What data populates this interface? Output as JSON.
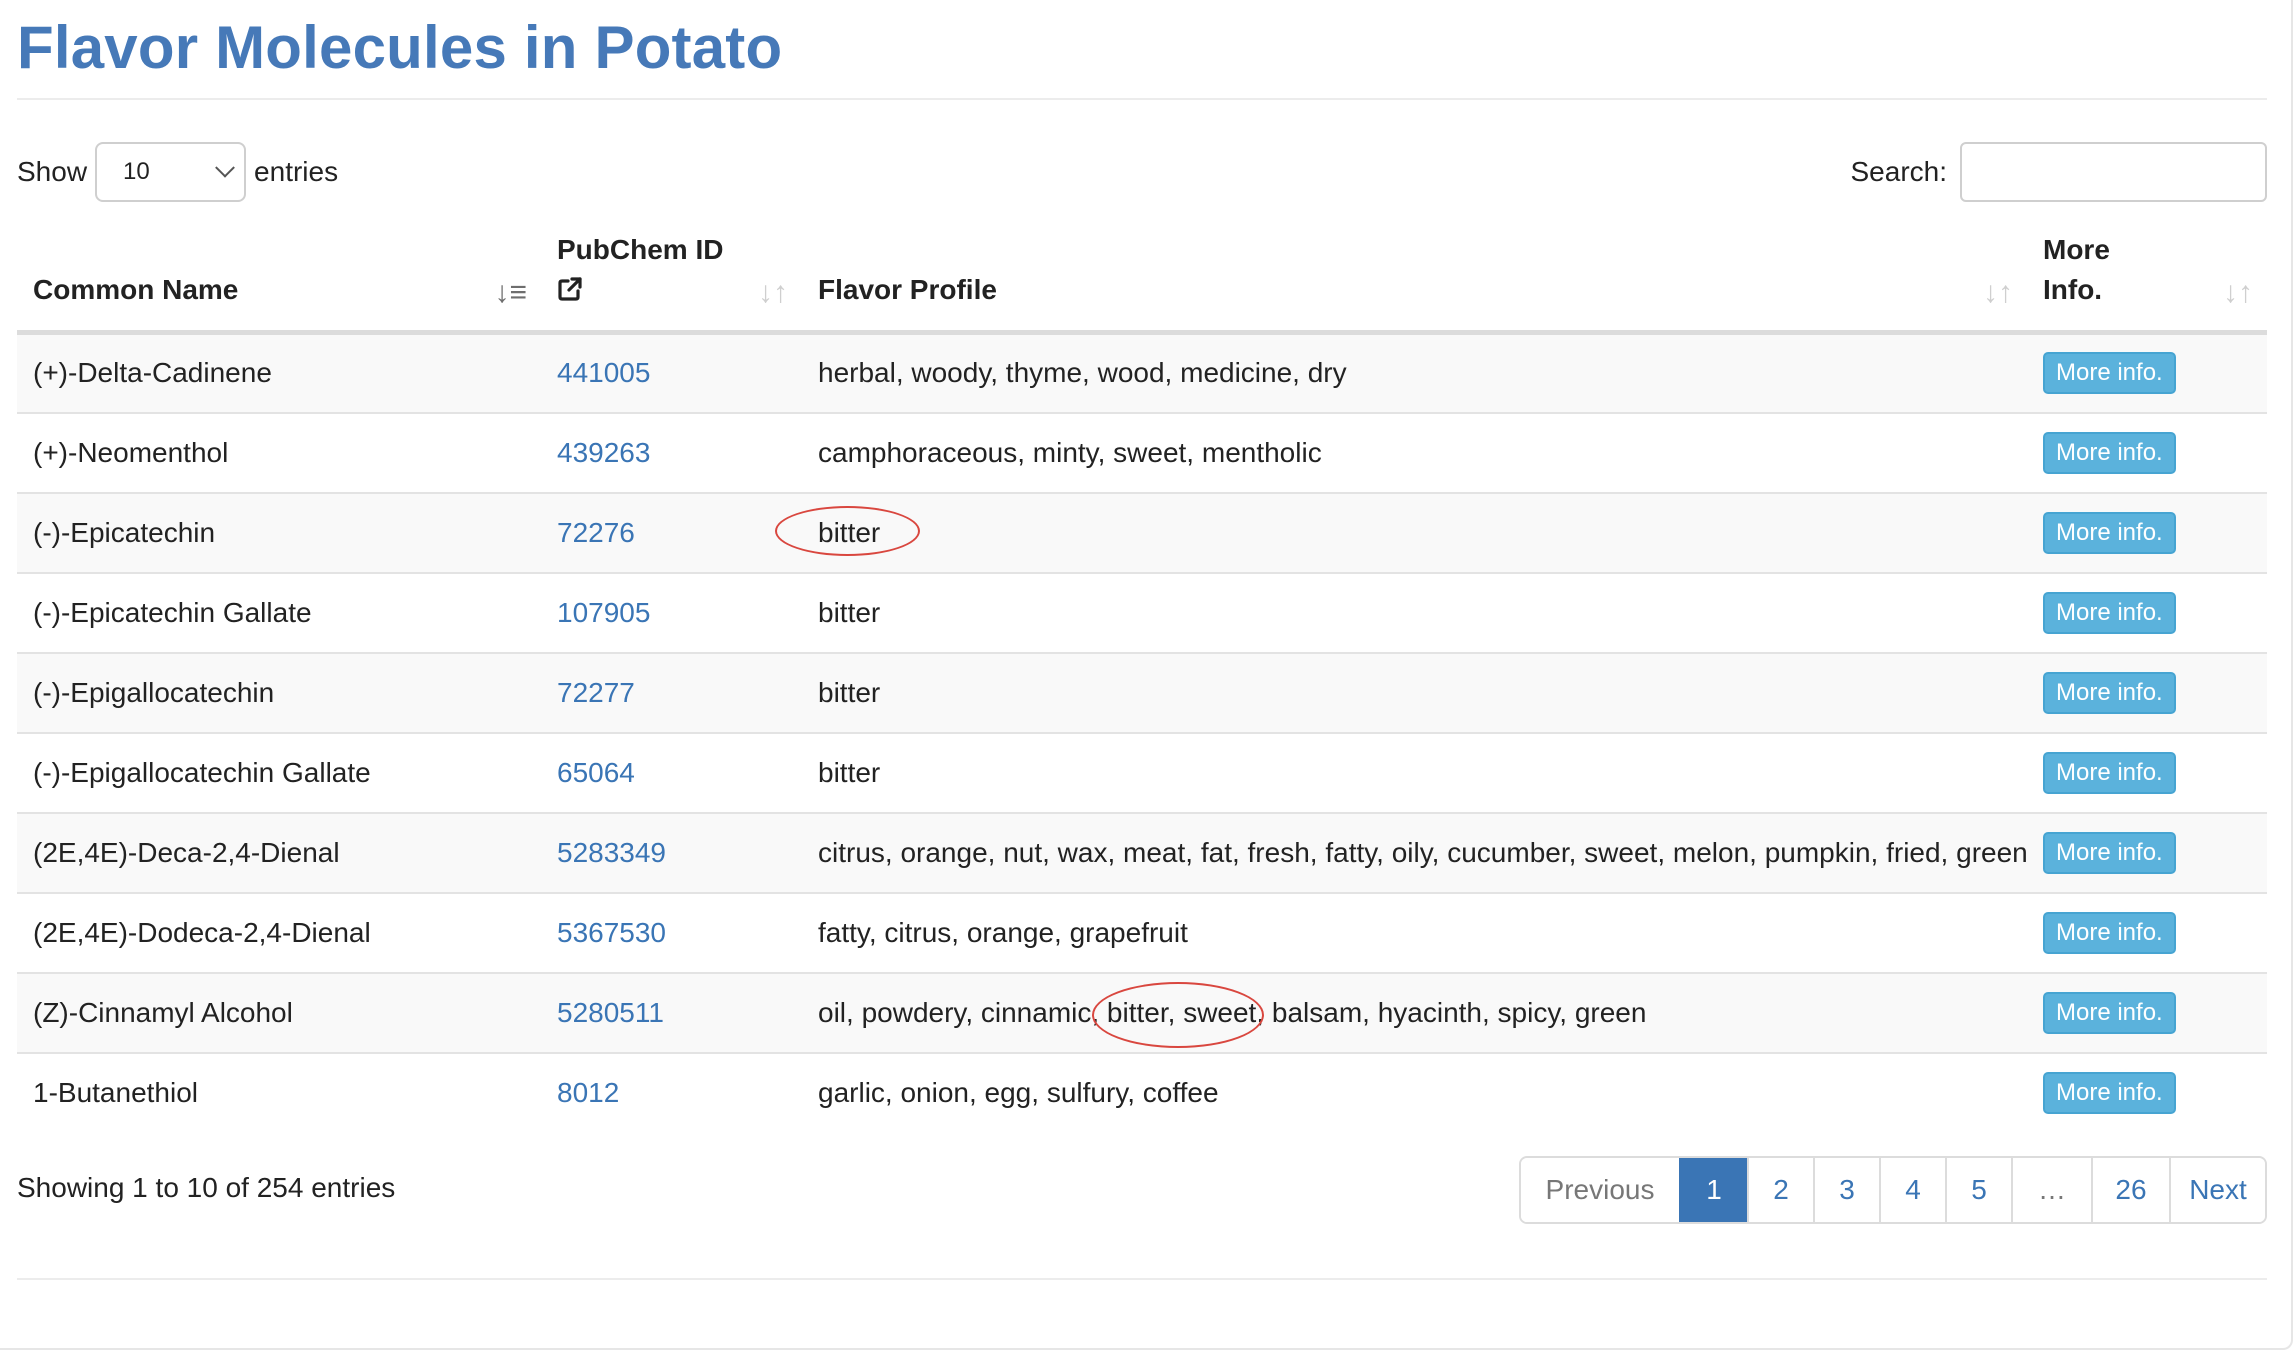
{
  "page": {
    "title": "Flavor Molecules in Potato"
  },
  "length_control": {
    "show_label": "Show",
    "selected": "10",
    "entries_label": "entries"
  },
  "search": {
    "label": "Search:",
    "value": "",
    "placeholder": ""
  },
  "table": {
    "headers": {
      "common_name": "Common Name",
      "pubchem_id": "PubChem ID",
      "flavor_profile": "Flavor Profile",
      "more_info_line1": "More",
      "more_info_line2": "Info."
    },
    "sort_state": {
      "sorted_column": "common_name",
      "direction": "ascending"
    },
    "rows": [
      {
        "name": "(+)-Delta-Cadinene",
        "pubchem_id": "441005",
        "flavor": "herbal, woody, thyme, wood, medicine, dry",
        "button": "More info."
      },
      {
        "name": "(+)-Neomenthol",
        "pubchem_id": "439263",
        "flavor": "camphoraceous, minty, sweet, mentholic",
        "button": "More info."
      },
      {
        "name": "(-)-Epicatechin",
        "pubchem_id": "72276",
        "flavor": "bitter",
        "button": "More info."
      },
      {
        "name": "(-)-Epicatechin Gallate",
        "pubchem_id": "107905",
        "flavor": "bitter",
        "button": "More info."
      },
      {
        "name": "(-)-Epigallocatechin",
        "pubchem_id": "72277",
        "flavor": "bitter",
        "button": "More info."
      },
      {
        "name": "(-)-Epigallocatechin Gallate",
        "pubchem_id": "65064",
        "flavor": "bitter",
        "button": "More info."
      },
      {
        "name": "(2E,4E)-Deca-2,4-Dienal",
        "pubchem_id": "5283349",
        "flavor": "citrus, orange, nut, wax, meat, fat, fresh, fatty, oily, cucumber, sweet, melon, pumpkin, fried, green",
        "button": "More info."
      },
      {
        "name": "(2E,4E)-Dodeca-2,4-Dienal",
        "pubchem_id": "5367530",
        "flavor": "fatty, citrus, orange, grapefruit",
        "button": "More info."
      },
      {
        "name": "(Z)-Cinnamyl Alcohol",
        "pubchem_id": "5280511",
        "flavor": "oil, powdery, cinnamic, bitter, sweet, balsam, hyacinth, spicy, green",
        "button": "More info."
      },
      {
        "name": "1-Butanethiol",
        "pubchem_id": "8012",
        "flavor": "garlic, onion, egg, sulfury, coffee",
        "button": "More info."
      }
    ]
  },
  "footer": {
    "info": "Showing 1 to 10 of 254 entries"
  },
  "pagination": {
    "previous": "Previous",
    "pages": [
      "1",
      "2",
      "3",
      "4",
      "5",
      "…",
      "26"
    ],
    "current_page": "1",
    "next": "Next"
  },
  "annotations": {
    "color": "#d9473f",
    "note": "hand-drawn red ellipses around 'bitter' (row 3) and 'bitter, sweet,' (row 9)"
  },
  "colors": {
    "title": "#4679b8",
    "link": "#3a75b5",
    "button": "#5bb2dc",
    "current_page": "#3a75b5"
  }
}
